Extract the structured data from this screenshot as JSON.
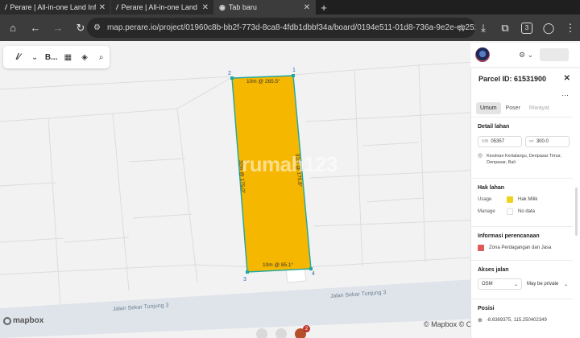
{
  "browser": {
    "tabs": [
      {
        "title": "Perare | All-in-one Land Info",
        "active": false
      },
      {
        "title": "Perare | All-in-one Land Info",
        "active": false
      },
      {
        "title": "Tab baru",
        "active": true
      }
    ],
    "url": "map.perare.io/project/01960c8b-bb2f-773d-8ca8-4fdb1dbbf34a/board/0194e511-01d8-736a-9e2e-ec252982bb4d",
    "ext_badge": "3"
  },
  "map": {
    "toolbar_label": "B...",
    "street_name": "Jalan Sekar Tunjung 3",
    "watermark": "rumah123",
    "attribution": "© Mapbox © Op",
    "mapbox_label": "mapbox",
    "corner_labels": [
      "1",
      "2",
      "3",
      "4"
    ],
    "edge_labels": {
      "top": "10m @ 265.5°",
      "right": "31m @ 175.8°",
      "left": "32m @ 175.0°",
      "bottom": "10m @ 85.1°"
    },
    "notification_badge": "2",
    "colors": {
      "parcel_fill": "#f5b700",
      "parcel_stroke": "#1fa7a0"
    }
  },
  "panel": {
    "parcel_id": "Parcel ID: 61531900",
    "tabs": [
      "Umum",
      "Poser",
      "Riwayat"
    ],
    "detail_title": "Detail lahan",
    "nib_prefix": "NIB",
    "nib_value": "05357",
    "luas_prefix": "m²",
    "luas_value": "300.0",
    "location": "Kesiman Kertalangu, Denpasar Timur, Denpasar, Bali",
    "hak_title": "Hak lahan",
    "usage_key": "Usage",
    "usage_value": "Hak Milik",
    "manage_key": "Manage",
    "manage_value": "No data",
    "perencanaan_title": "Informasi perencanaan",
    "zona_value": "Zona Perdagangan dan Jasa",
    "akses_title": "Akses jalan",
    "osm_label": "OSM",
    "private_label": "May be private",
    "posisi_title": "Posisi",
    "posisi_value": "-8.6369375, 115.250402349"
  }
}
